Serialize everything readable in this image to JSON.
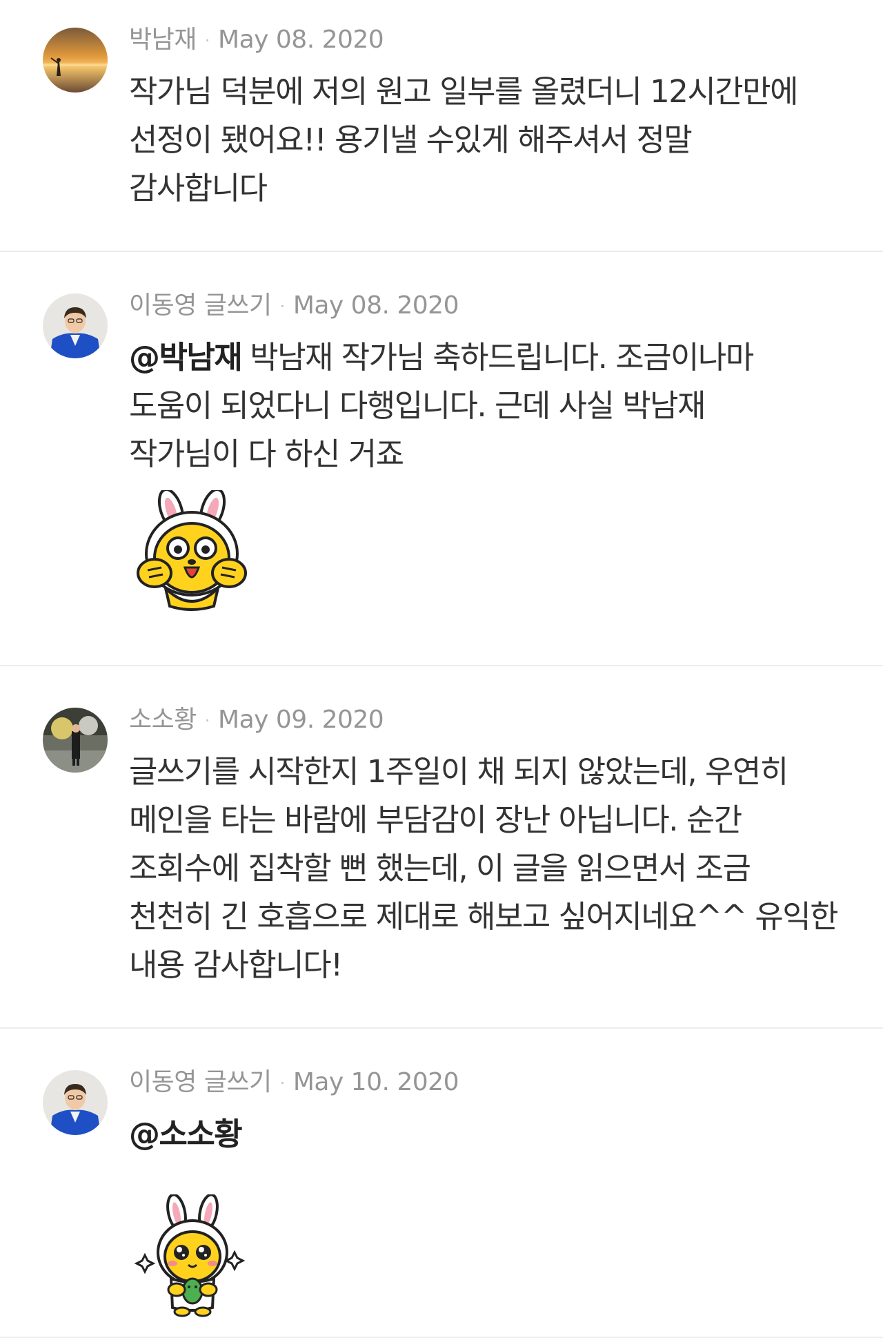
{
  "comments": [
    {
      "author": "박남재",
      "date": "May 08. 2020",
      "mention": "",
      "lines": [
        "작가님 덕분에 저의 원고 일부를 올렸더니 12시간만에",
        "선정이 됐어요!! 용기낼 수있게 해주셔서 정말",
        "감사합니다"
      ],
      "sticker": ""
    },
    {
      "author": "이동영 글쓰기",
      "date": "May 08. 2020",
      "mention": "@박남재",
      "lines": [
        "박남재 작가님 축하드립니다. 조금이나마",
        "도움이 되었다니 다행입니다. 근데 사실 박남재",
        "작가님이 다 하신 거죠"
      ],
      "sticker": "rabbit-character-sticker"
    },
    {
      "author": "소소황",
      "date": "May 09. 2020",
      "mention": "",
      "lines": [
        "글쓰기를 시작한지 1주일이 채 되지 않았는데, 우연히",
        "메인을 타는 바람에 부담감이 장난 아닙니다. 순간",
        "조회수에 집착할 뻔 했는데, 이 글을 읽으면서 조금",
        "천천히 긴 호흡으로 제대로 해보고 싶어지네요^^ 유익한",
        "내용 감사합니다!"
      ],
      "sticker": ""
    },
    {
      "author": "이동영 글쓰기",
      "date": "May 10. 2020",
      "mention": "@소소황",
      "lines": [],
      "sticker": "rabbit-character-hug-sticker"
    }
  ],
  "colors": {
    "meta_text": "#959595",
    "body_text": "#333333",
    "divider": "#ececec",
    "sticker_yellow": "#ffd21e",
    "sticker_pink": "#f5a9b8"
  },
  "separator": "·"
}
